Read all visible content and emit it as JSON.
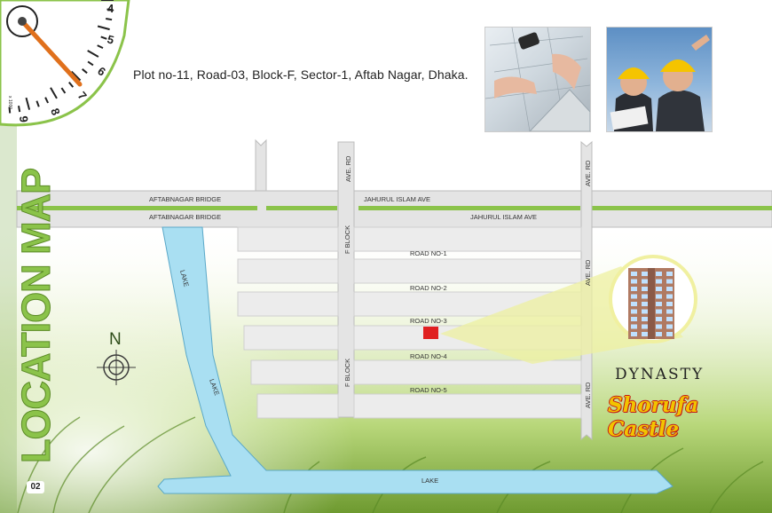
{
  "address": "Plot no-11, Road-03, Block-F, Sector-1, Aftab Nagar, Dhaka.",
  "title": "LOCATION MAP",
  "page_number": "02",
  "compass_north": "N",
  "gauge": {
    "numbers": [
      "4",
      "5",
      "6",
      "7",
      "8",
      "9"
    ],
    "unit": "x 1000"
  },
  "brand": {
    "top": "DYNASTY",
    "main": "Shorufa Castle"
  },
  "roads": {
    "bridge_top": "AFTABNAGAR BRIDGE",
    "bridge_bottom": "AFTABNAGAR BRIDGE",
    "avenue_top": "JAHURUL ISLAM AVE",
    "avenue_bottom": "JAHURUL ISLAM AVE",
    "ave_rd_1": "AVE. RD",
    "ave_rd_2": "AVE. RD",
    "ave_rd_3": "AVE. RD",
    "ave_rd_4": "AVE. RD",
    "f_block_1": "F BLOCK",
    "f_block_2": "F BLOCK",
    "road_1": "ROAD NO-1",
    "road_2": "ROAD NO-2",
    "road_3": "ROAD NO-3",
    "road_4": "ROAD NO-4",
    "road_5": "ROAD NO-5",
    "lake_1": "LAKE",
    "lake_2": "LAKE",
    "lake_3": "LAKE"
  },
  "colors": {
    "lake": "#a9dff2",
    "road": "#e4e4e4",
    "green_strip": "#8bc34a",
    "marker": "#e02020",
    "highlight": "#eef0a0"
  }
}
